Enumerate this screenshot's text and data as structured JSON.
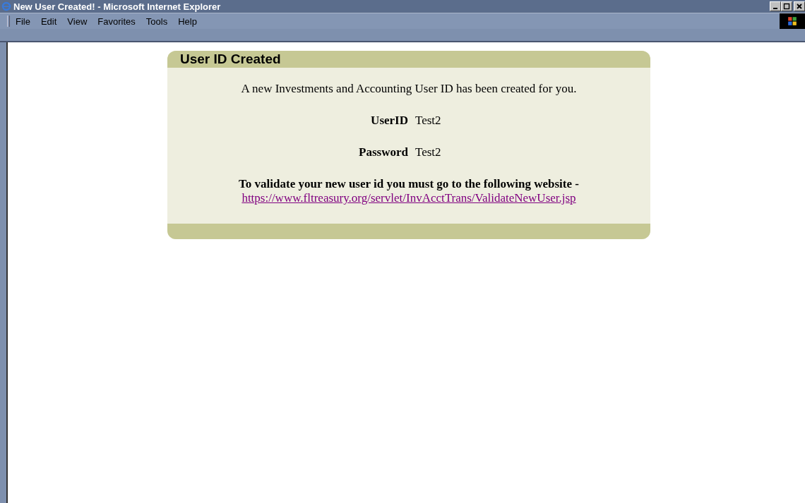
{
  "window": {
    "title": "New User Created! - Microsoft Internet Explorer"
  },
  "menu": [
    "File",
    "Edit",
    "View",
    "Favorites",
    "Tools",
    "Help"
  ],
  "panel": {
    "title": "User ID Created",
    "message": "A new Investments and Accounting User ID has been created for you.",
    "fields": [
      {
        "label": "UserID",
        "value": "Test2"
      },
      {
        "label": "Password",
        "value": "Test2"
      }
    ],
    "instruction": "To validate your new user id you must go to the following website -",
    "link": "https://www.fltreasury.org/servlet/InvAcctTrans/ValidateNewUser.jsp"
  }
}
